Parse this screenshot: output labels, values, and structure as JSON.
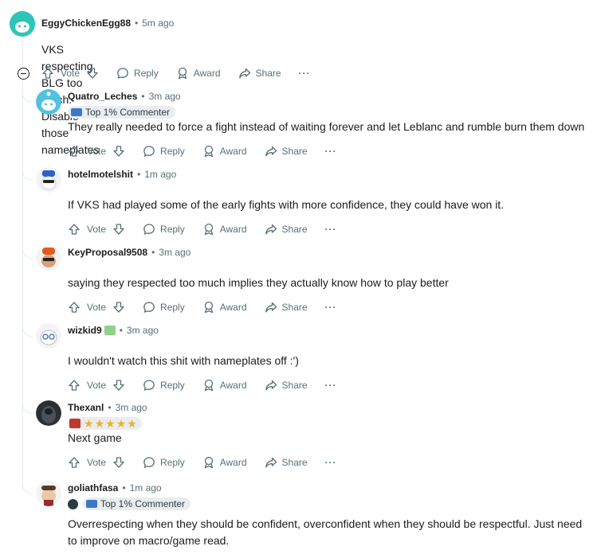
{
  "root": {
    "author": "EggyChickenEgg88",
    "time": "5m ago",
    "body": "VKS respecting BLG too much. Disable those nameplates",
    "avatar_color": "#2ec4b6"
  },
  "actions": {
    "vote": "Vote",
    "reply": "Reply",
    "award": "Award",
    "share": "Share",
    "more": "···"
  },
  "replies": [
    {
      "author": "Quatro_Leches",
      "time": "3m ago",
      "flair": "Top 1% Commenter",
      "body": "They really needed to force a fight instead of waiting forever and let Leblanc and rumble burn them down"
    },
    {
      "author": "hotelmotelshit",
      "time": "1m ago",
      "body": "If VKS had played some of the early fights with more confidence, they could have won it."
    },
    {
      "author": "KeyProposal9508",
      "time": "3m ago",
      "body": "saying they respected too much implies they actually know how to play better"
    },
    {
      "author": "wizkid9",
      "time": "3m ago",
      "body": "I wouldn't watch this shit with nameplates off :')"
    },
    {
      "author": "Thexanl",
      "time": "3m ago",
      "body": "Next game"
    },
    {
      "author": "goliathfasa",
      "time": "1m ago",
      "flair": "Top 1% Commenter",
      "body_line1": "Overrespecting when they should be confident, overconfident when they should be respectful. Just need",
      "body_line2": "to improve on macro/game read."
    }
  ],
  "colors": {
    "meta": "#576f76",
    "flair_bg": "#eaedef",
    "thread_line": "#e5ebee",
    "star": "#f2b01e"
  }
}
